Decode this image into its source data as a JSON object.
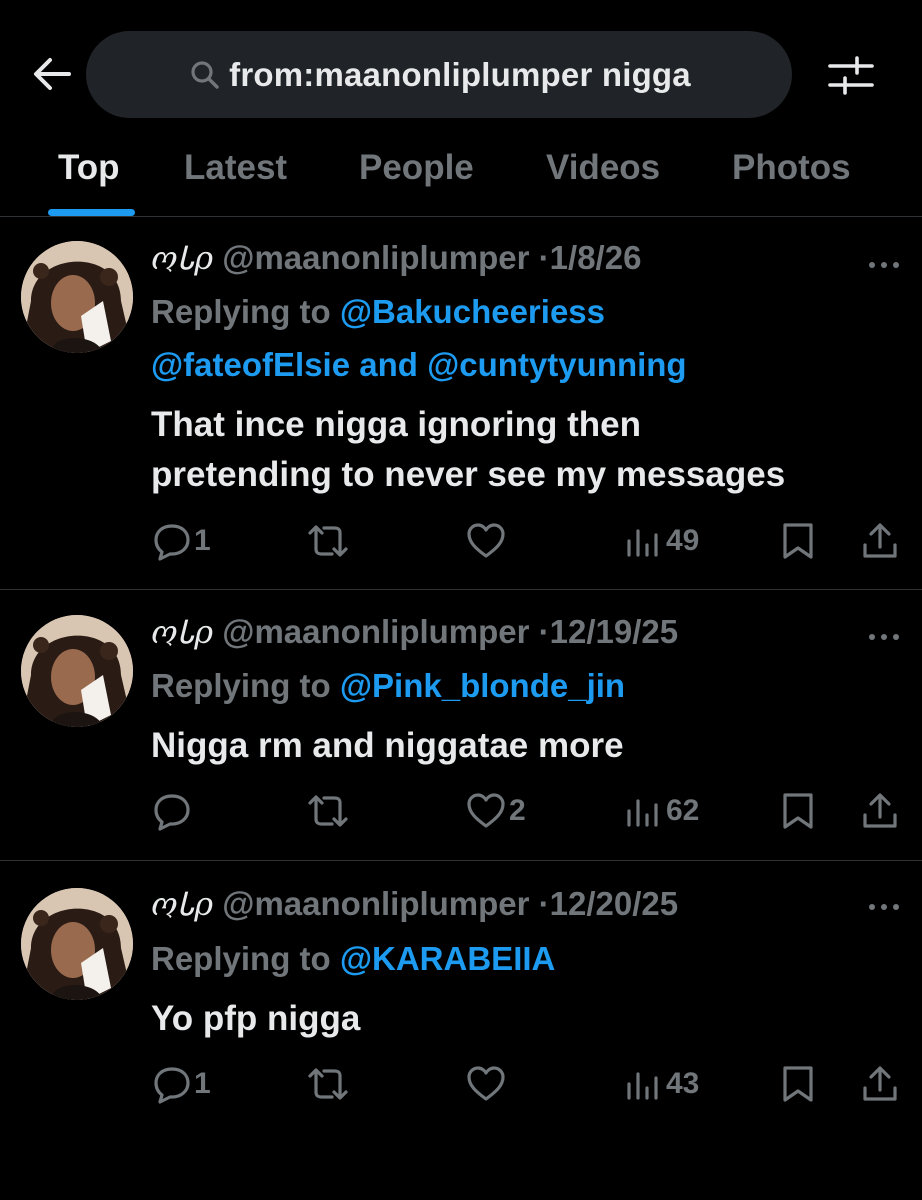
{
  "search": {
    "query": "from:maanonliplumper nigga",
    "back_icon": "back-arrow-icon",
    "search_icon": "search-icon",
    "filter_icon": "filter-sliders-icon"
  },
  "tabs": [
    {
      "label": "Top",
      "active": true
    },
    {
      "label": "Latest",
      "active": false
    },
    {
      "label": "People",
      "active": false
    },
    {
      "label": "Videos",
      "active": false
    },
    {
      "label": "Photos",
      "active": false
    }
  ],
  "tweets": [
    {
      "display_name": "ოᏓρ",
      "handle": "@maanonliplumper",
      "date": "1/8/26",
      "replying_prefix": "Replying to",
      "reply_line1": "@Bakucheeriess",
      "reply_line2_a": "@fateofElsie",
      "reply_line2_and": "and",
      "reply_line2_b": "@cuntytyunning",
      "text_line1": "That ince nigga ignoring then",
      "text_line2": "pretending to never see my messages",
      "replies": "1",
      "reposts": "",
      "likes": "",
      "views": "49"
    },
    {
      "display_name": "ოᏓρ",
      "handle": "@maanonliplumper",
      "date": "12/19/25",
      "replying_prefix": "Replying to",
      "reply_line1": "@Pink_blonde_jin",
      "text_line1": "Nigga rm and niggatae more",
      "replies": "",
      "reposts": "",
      "likes": "2",
      "views": "62"
    },
    {
      "display_name": "ოᏓρ",
      "handle": "@maanonliplumper",
      "date": "12/20/25",
      "replying_prefix": "Replying to",
      "reply_line1": "@KARABEIIA",
      "text_line1": "Yo pfp nigga",
      "replies": "1",
      "reposts": "",
      "likes": "",
      "views": "43"
    }
  ],
  "colors": {
    "background": "#000000",
    "text": "#e7e9ea",
    "muted": "#71767b",
    "accent": "#1d9bf0",
    "search_bg": "#202327",
    "divider": "#2f3336"
  }
}
